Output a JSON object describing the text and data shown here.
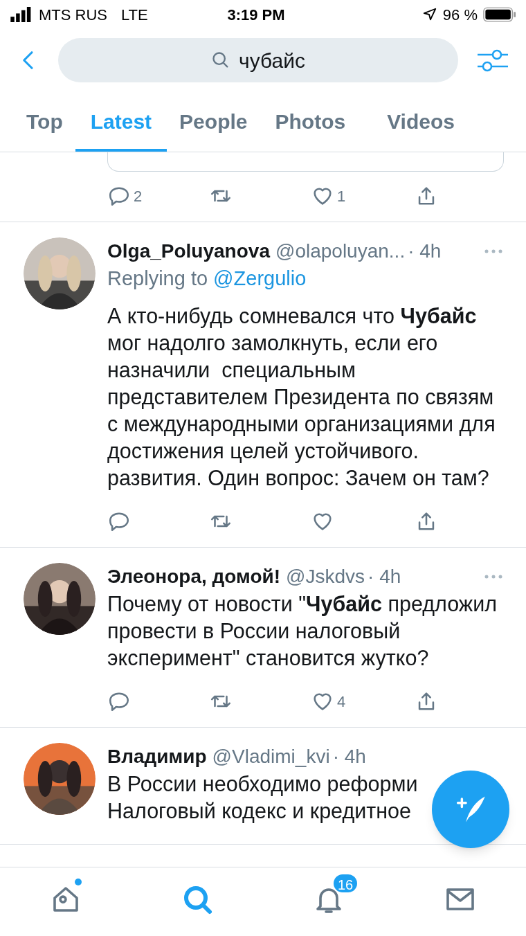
{
  "status_bar": {
    "carrier": "MTS RUS",
    "network": "LTE",
    "time": "3:19 PM",
    "battery": "96 %"
  },
  "search": {
    "query": "чубайс"
  },
  "tabs": [
    {
      "label": "Top",
      "selected": false
    },
    {
      "label": "Latest",
      "selected": true
    },
    {
      "label": "People",
      "selected": false
    },
    {
      "label": "Photos",
      "selected": false
    },
    {
      "label": "Videos",
      "selected": false
    }
  ],
  "tweets": [
    {
      "kind": "partial",
      "replies": "2",
      "likes": "1"
    },
    {
      "kind": "full",
      "name": "Olga_Poluyanova",
      "handle": "@olapoluyan...",
      "time": "· 4h",
      "replying_to_label": "Replying to",
      "replying_to": "@Zergulio",
      "text": "А кто-нибудь сомневался что **Чубайс** мог надолго замолкнуть, если его назначили  специальным представителем Президента по связям с международными организациями для достижения целей устойчивого.  развития. Один вопрос: Зачем он там?"
    },
    {
      "kind": "full",
      "name": "Элеонора, домой!",
      "handle": "@Jskdvs",
      "time": "· 4h",
      "text": "Почему от новости \"**Чубайс** предложил провести в России налоговый эксперимент\" становится жутко?",
      "likes": "4"
    },
    {
      "kind": "cut",
      "name": "Владимир",
      "handle": "@Vladimi_kvi",
      "time": "· 4h",
      "text": "В России необходимо реформи Налоговый кодекс и кредитное"
    }
  ],
  "nav": [
    {
      "kind": "home",
      "selected": false,
      "dot": true
    },
    {
      "kind": "search",
      "selected": true,
      "dot": false
    },
    {
      "kind": "notifications",
      "selected": false,
      "dot": false,
      "badge": "16"
    },
    {
      "kind": "messages",
      "selected": false,
      "dot": false
    }
  ]
}
